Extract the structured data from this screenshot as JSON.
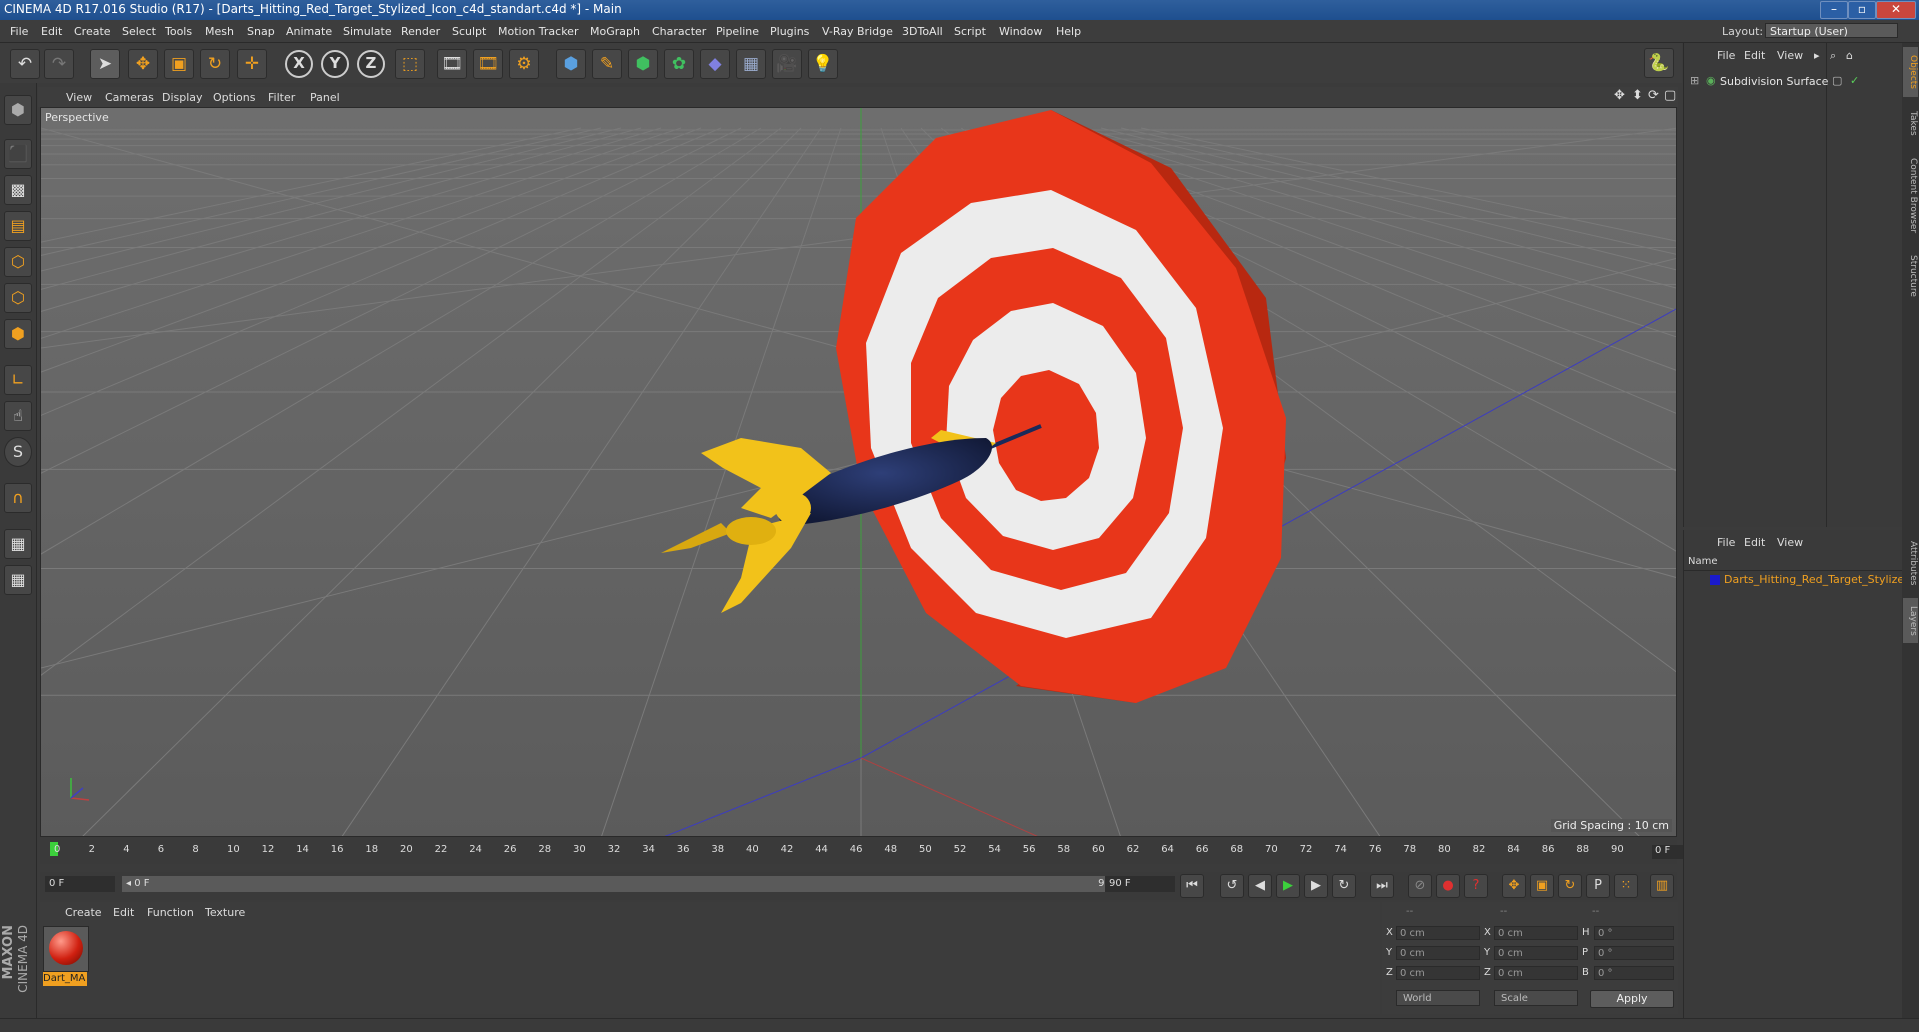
{
  "window": {
    "title": "CINEMA 4D R17.016 Studio (R17) - [Darts_Hitting_Red_Target_Stylized_Icon_c4d_standart.c4d *] - Main"
  },
  "menu": [
    "File",
    "Edit",
    "Create",
    "Select",
    "Tools",
    "Mesh",
    "Snap",
    "Animate",
    "Simulate",
    "Render",
    "Sculpt",
    "Motion Tracker",
    "MoGraph",
    "Character",
    "Pipeline",
    "Plugins",
    "V-Ray Bridge",
    "3DToAll",
    "Script",
    "Window",
    "Help"
  ],
  "layout": {
    "label": "Layout:",
    "value": "Startup (User)"
  },
  "toolbar": {
    "undo": "undo-icon",
    "redo": "redo-icon",
    "axis_x": "X",
    "axis_y": "Y",
    "axis_z": "Z"
  },
  "viewport": {
    "menu": [
      "View",
      "Cameras",
      "Display",
      "Options",
      "Filter",
      "Panel"
    ],
    "camera": "Perspective",
    "grid_spacing": "Grid Spacing : 10 cm"
  },
  "timeline": {
    "ticks": [
      "0",
      "2",
      "4",
      "6",
      "8",
      "10",
      "12",
      "14",
      "16",
      "18",
      "20",
      "22",
      "24",
      "26",
      "28",
      "30",
      "32",
      "34",
      "36",
      "38",
      "40",
      "42",
      "44",
      "46",
      "48",
      "50",
      "52",
      "54",
      "56",
      "58",
      "60",
      "62",
      "64",
      "66",
      "68",
      "70",
      "72",
      "74",
      "76",
      "78",
      "80",
      "82",
      "84",
      "86",
      "88",
      "90"
    ],
    "current_frame": "0 F"
  },
  "transport": {
    "start": "0 F",
    "range_start": "◂ 0 F",
    "range_end": "90 F ▸",
    "end": "90 F"
  },
  "materials": {
    "menu": [
      "Create",
      "Edit",
      "Function",
      "Texture"
    ],
    "items": [
      {
        "name": "Dart_MA"
      }
    ]
  },
  "coordinates": {
    "header": [
      "--",
      "--",
      "--"
    ],
    "rows": [
      {
        "a": "X",
        "av": "0 cm",
        "b": "X",
        "bv": "0 cm",
        "c": "H",
        "cv": "0 °"
      },
      {
        "a": "Y",
        "av": "0 cm",
        "b": "Y",
        "bv": "0 cm",
        "c": "P",
        "cv": "0 °"
      },
      {
        "a": "Z",
        "av": "0 cm",
        "b": "Z",
        "bv": "0 cm",
        "c": "B",
        "cv": "0 °"
      }
    ],
    "world": "World",
    "scale": "Scale",
    "apply": "Apply"
  },
  "objects": {
    "menu": [
      "File",
      "Edit",
      "View"
    ],
    "items": [
      {
        "name": "Subdivision Surface"
      }
    ]
  },
  "layers": {
    "menu": [
      "File",
      "Edit",
      "View"
    ],
    "column": "Name",
    "items": [
      {
        "name": "Darts_Hitting_Red_Target_Stylized",
        "color": "#1a1acc"
      }
    ]
  },
  "side_tabs": [
    "Objects",
    "Takes",
    "Content Browser",
    "Structure",
    "Attributes",
    "Layers"
  ],
  "brand": {
    "line1": "MAXON",
    "line2": "CINEMA 4D"
  },
  "colors": {
    "accent": "#f0a020",
    "target_red": "#e8361a",
    "target_white": "#e8e8e8",
    "dart_yellow": "#f2c21a",
    "dart_blue": "#1a2a5a"
  }
}
